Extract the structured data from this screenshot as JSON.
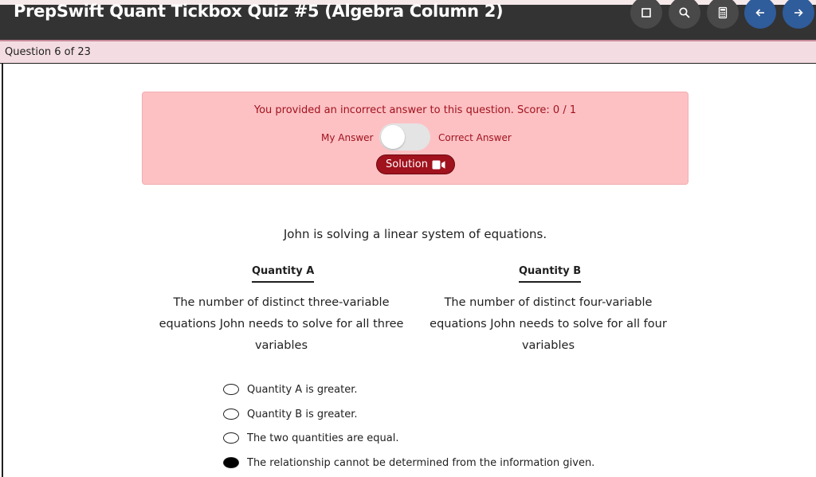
{
  "header": {
    "title": "PrepSwift Quant Tickbox Quiz #5 (Algebra Column 2)",
    "buttons": [
      {
        "name": "square-icon"
      },
      {
        "name": "search-icon"
      },
      {
        "name": "calculator-icon"
      },
      {
        "name": "arrow-left-icon"
      },
      {
        "name": "arrow-right-icon"
      }
    ]
  },
  "progress": {
    "text": "Question 6 of 23"
  },
  "feedback": {
    "message": "You provided an incorrect answer to this question. Score: 0 / 1",
    "my_answer_label": "My Answer",
    "correct_answer_label": "Correct Answer",
    "toggle_state": "my-answer",
    "solution_label": "Solution"
  },
  "question": {
    "stem": "John is solving a linear system of equations.",
    "quantity_a": {
      "heading": "Quantity A",
      "text": "The number of distinct three-variable equations John needs to solve for all three variables"
    },
    "quantity_b": {
      "heading": "Quantity B",
      "text": "The number of distinct four-variable equations John needs to solve for all four variables"
    },
    "options": [
      {
        "label": "Quantity A is greater.",
        "selected": false
      },
      {
        "label": "Quantity B is greater.",
        "selected": false
      },
      {
        "label": "The two quantities are equal.",
        "selected": false
      },
      {
        "label": "The relationship cannot be determined from the information given.",
        "selected": true
      }
    ]
  },
  "colors": {
    "header_bg": "#333333",
    "nav_blue": "#2f5c9a",
    "feedback_bg": "#fdc1c4",
    "feedback_text": "#a1121d",
    "solution_button": "#a0121d"
  }
}
